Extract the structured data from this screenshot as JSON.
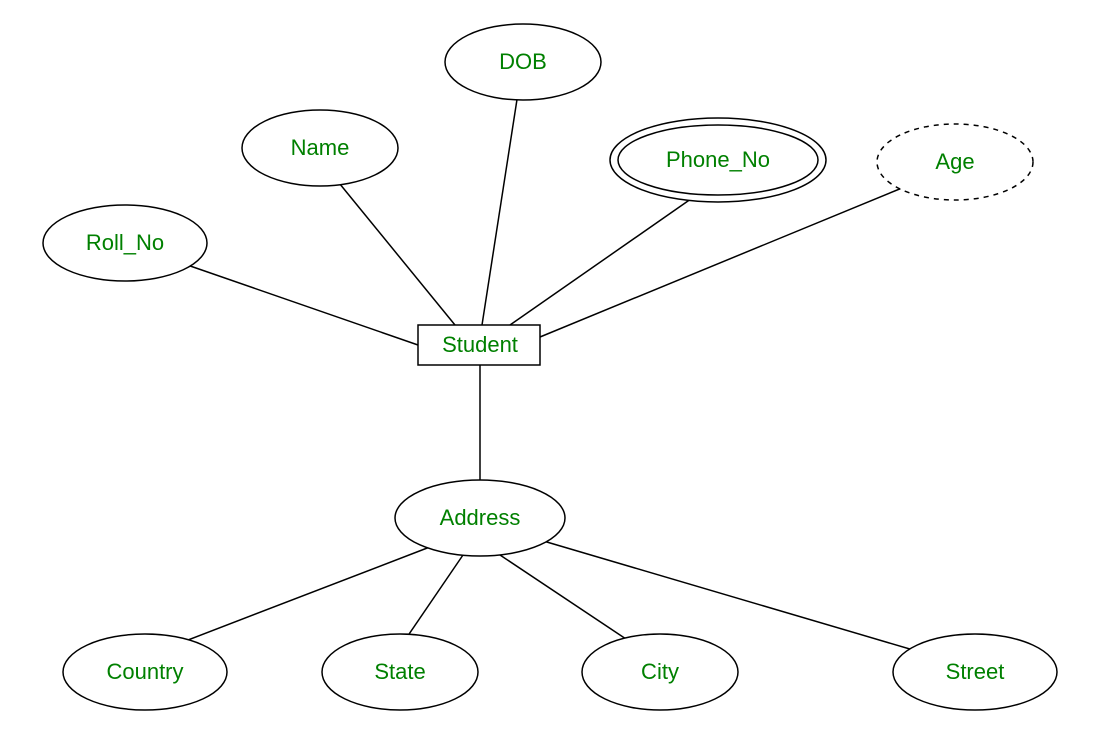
{
  "entity": {
    "student": "Student"
  },
  "attributes": {
    "rollNo": "Roll_No",
    "name": "Name",
    "dob": "DOB",
    "phoneNo": "Phone_No",
    "age": "Age",
    "address": "Address"
  },
  "composite": {
    "country": "Country",
    "state": "State",
    "city": "City",
    "street": "Street"
  }
}
